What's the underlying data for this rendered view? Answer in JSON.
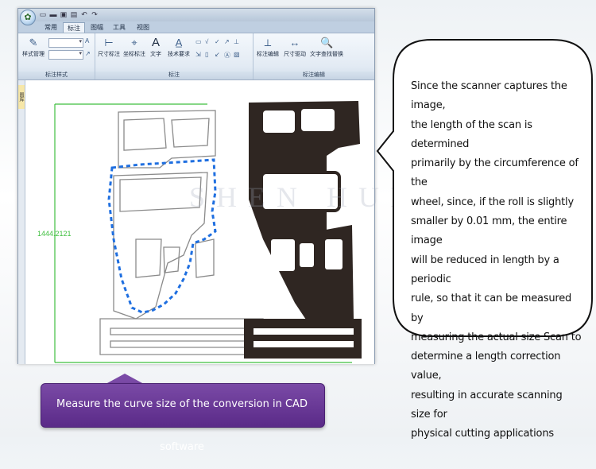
{
  "window": {
    "qat_icons": [
      "new-file-icon",
      "open-folder-icon",
      "save-icon",
      "print-icon",
      "undo-icon",
      "redo-icon"
    ],
    "tabs": [
      "常用",
      "标注",
      "图幅",
      "工具",
      "视图"
    ],
    "active_tab": "标注"
  },
  "ribbon": {
    "groups": [
      {
        "label": "标注样式",
        "buttons": [
          {
            "label": "样式管理",
            "icon": "style-manager-icon"
          }
        ]
      },
      {
        "label": "标注",
        "buttons": [
          {
            "label": "尺寸标注",
            "icon": "dimension-icon"
          },
          {
            "label": "坐标标注",
            "icon": "coordinate-icon"
          },
          {
            "label": "文字",
            "icon": "text-icon"
          },
          {
            "label": "技术要求",
            "icon": "tech-requirement-icon"
          }
        ]
      },
      {
        "label": "标注编辑",
        "buttons": [
          {
            "label": "标注编辑",
            "icon": "edit-dimension-icon"
          },
          {
            "label": "尺寸驱动",
            "icon": "dimension-drive-icon"
          },
          {
            "label": "文字查找替换",
            "icon": "find-replace-icon"
          }
        ]
      }
    ]
  },
  "sidebar": {
    "tab_label": "图库"
  },
  "canvas": {
    "dimension_text": "1444.2121",
    "watermark": "SHEN HUI AO"
  },
  "colors": {
    "dimension_green": "#3fbf3f",
    "selection_blue": "#1f6fe0",
    "part_fill": "#2f2622",
    "caption_purple": "#6a3a98"
  },
  "bubble": {
    "lines": [
      "Since the scanner captures the image,",
      "the length of the scan is determined",
      "primarily by the circumference of the",
      "wheel, since, if the roll is slightly",
      "smaller by 0.01 mm, the entire image",
      "will be reduced in length by a periodic",
      "rule, so that it can be measured by",
      "measuring the actual size Scan to",
      "determine a length correction value,",
      "resulting in accurate scanning size for",
      "physical cutting applications"
    ]
  },
  "caption": {
    "text": "Measure the curve size of the conversion in CAD software"
  }
}
